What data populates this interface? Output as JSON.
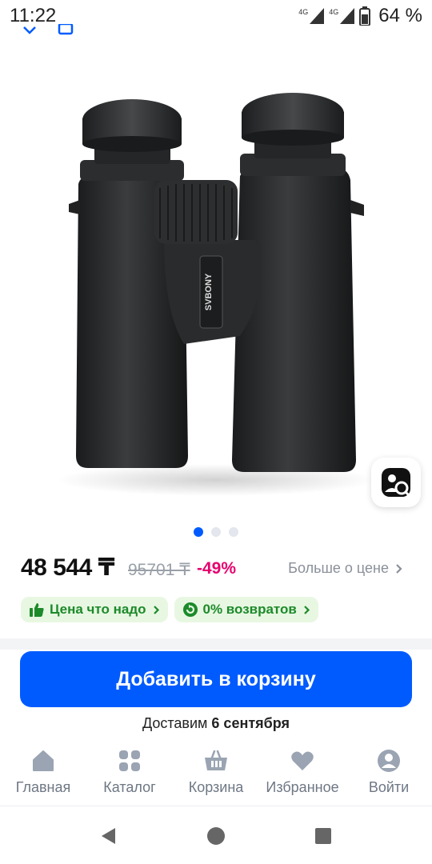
{
  "status_bar": {
    "time": "11:22",
    "network_1": "4G",
    "network_2": "4G",
    "battery": "64 %"
  },
  "product": {
    "brand_on_image": "SVBONY",
    "images_count": 3,
    "active_image": 1
  },
  "price": {
    "current": "48 544 ₸",
    "old": "95701 ₸",
    "discount": "-49%",
    "more_link": "Больше о цене"
  },
  "badges": [
    {
      "label": "Цена что надо",
      "icon": "thumbs-up-icon"
    },
    {
      "label": "0% возвратов",
      "icon": "return-icon"
    }
  ],
  "cart_button": "Добавить в корзину",
  "delivery": {
    "prefix": "Доставим",
    "date": "6 сентября"
  },
  "bottom_nav": [
    {
      "label": "Главная",
      "icon": "home-icon"
    },
    {
      "label": "Каталог",
      "icon": "catalog-icon"
    },
    {
      "label": "Корзина",
      "icon": "basket-icon"
    },
    {
      "label": "Избранное",
      "icon": "heart-icon"
    },
    {
      "label": "Войти",
      "icon": "profile-icon"
    }
  ],
  "colors": {
    "accent": "#005bff",
    "discount": "#e6006e",
    "badge_bg": "#e8f7e2",
    "badge_fg": "#1c8a2a",
    "nav_icon": "#9aa4b2"
  }
}
